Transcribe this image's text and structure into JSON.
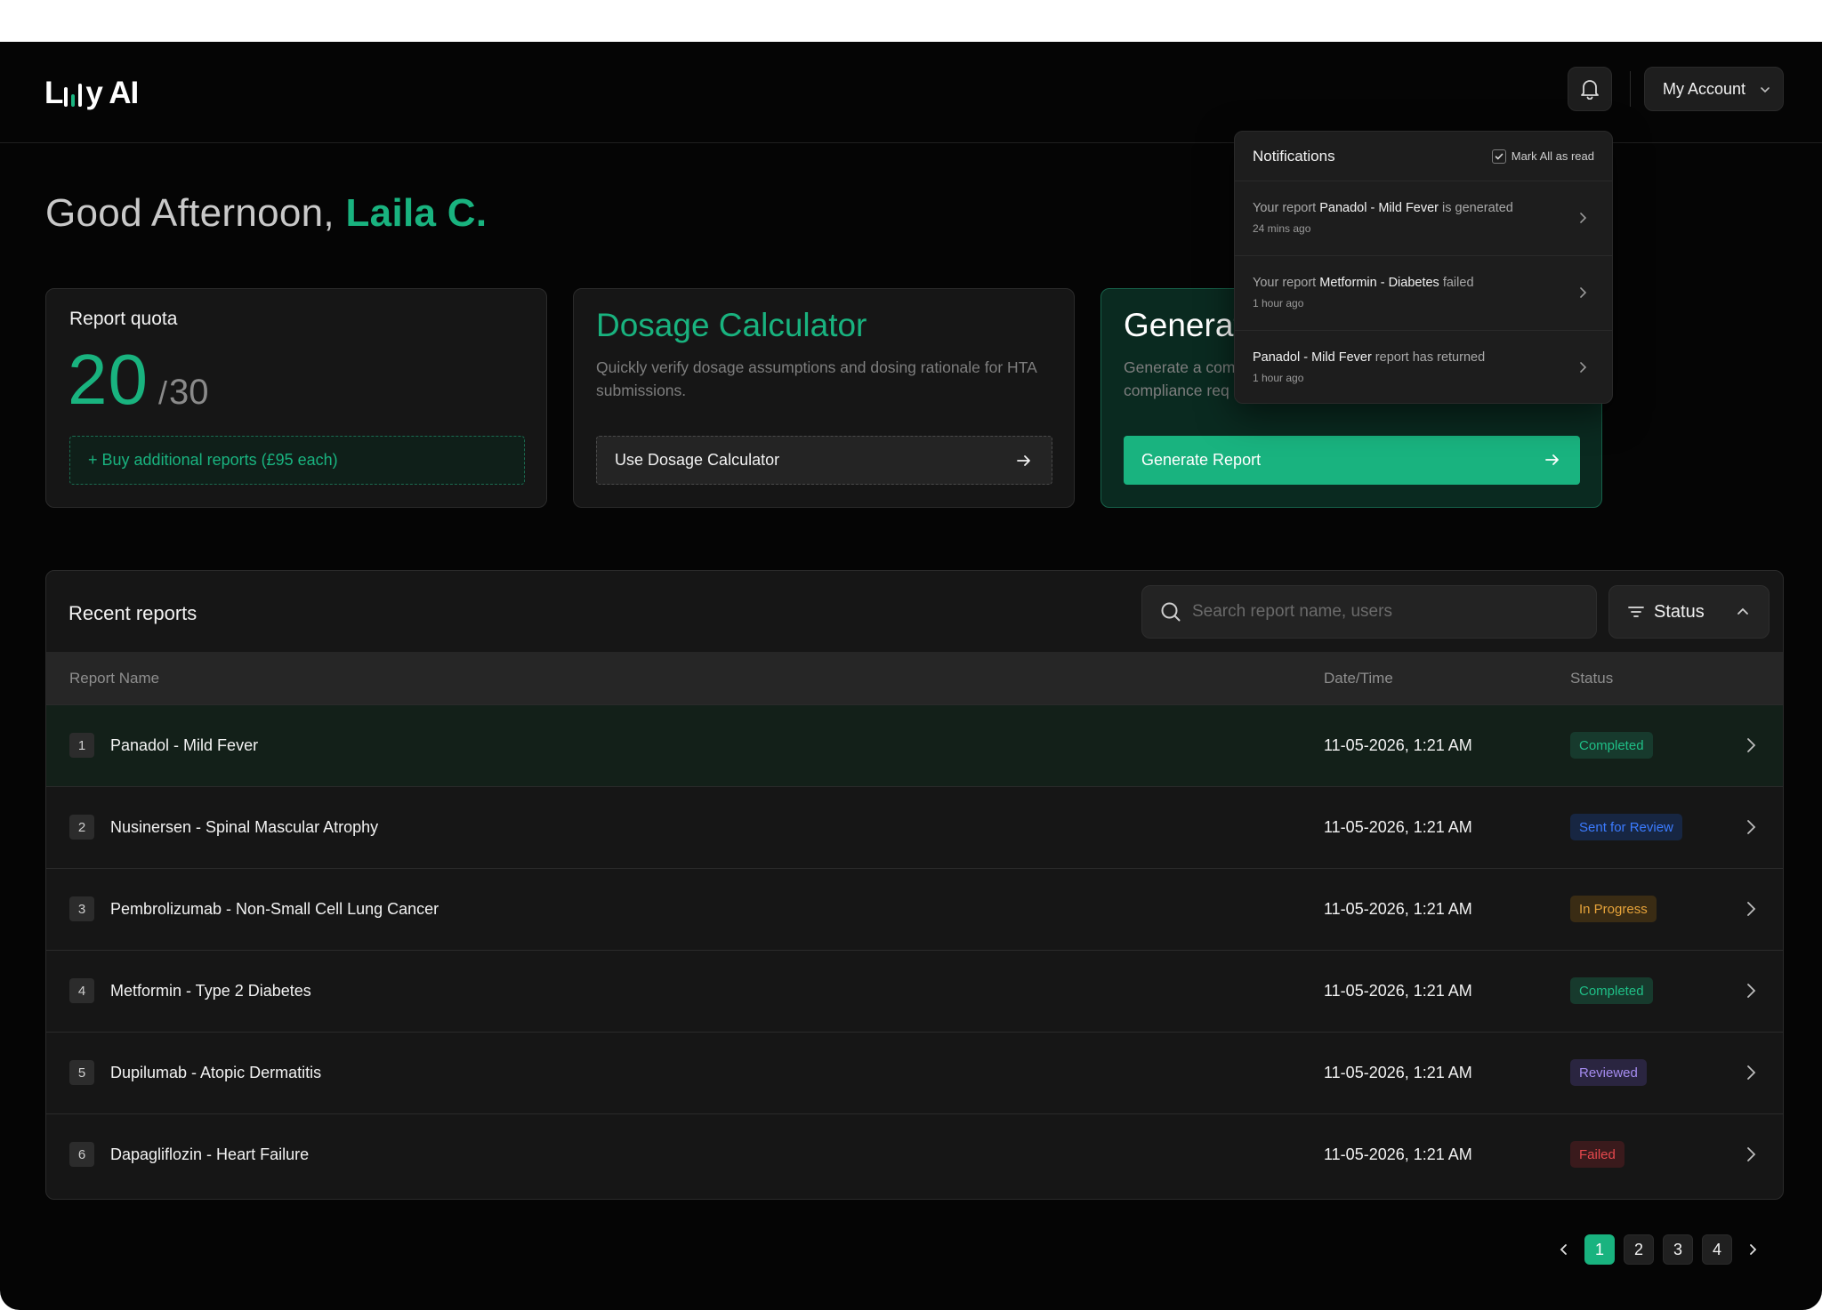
{
  "header": {
    "logo_prefix": "L",
    "logo_suffix": "y AI",
    "account_label": "My Account"
  },
  "greeting": {
    "prefix": "Good Afternoon,",
    "name": "Laila C."
  },
  "quota": {
    "title": "Report quota",
    "used": "20",
    "total": "30",
    "buy_label": "+ Buy additional reports (£95 each)"
  },
  "dosage": {
    "title": "Dosage Calculator",
    "description": "Quickly verify dosage assumptions and dosing rationale for HTA submissions.",
    "button_label": "Use Dosage Calculator"
  },
  "generate": {
    "title": "Generat",
    "description_line1": "Generate a com",
    "description_line2": "compliance req",
    "button_label": "Generate Report"
  },
  "notifications": {
    "title": "Notifications",
    "mark_all_label": "Mark All as read",
    "items": [
      {
        "pre": "Your report ",
        "bold": "Panadol - Mild Fever",
        "post": " is generated",
        "time": "24 mins ago"
      },
      {
        "pre": "Your report ",
        "bold": "Metformin - Diabetes",
        "post": " failed",
        "time": "1 hour ago"
      },
      {
        "pre": "",
        "bold": "Panadol - Mild Fever",
        "post": " report has returned",
        "time": "1 hour ago"
      }
    ]
  },
  "reports": {
    "title": "Recent reports",
    "search_placeholder": "Search report name, users",
    "status_filter_label": "Status",
    "columns": {
      "name": "Report Name",
      "date": "Date/Time",
      "status": "Status"
    },
    "rows": [
      {
        "index": "1",
        "name": "Panadol - Mild Fever",
        "date": "11-05-2026, 1:21 AM",
        "status": "Completed"
      },
      {
        "index": "2",
        "name": "Nusinersen - Spinal Mascular Atrophy",
        "date": "11-05-2026, 1:21 AM",
        "status": "Sent for Review"
      },
      {
        "index": "3",
        "name": "Pembrolizumab - Non-Small Cell Lung Cancer",
        "date": "11-05-2026, 1:21 AM",
        "status": "In Progress"
      },
      {
        "index": "4",
        "name": "Metformin - Type 2 Diabetes",
        "date": "11-05-2026, 1:21 AM",
        "status": "Completed"
      },
      {
        "index": "5",
        "name": "Dupilumab - Atopic Dermatitis",
        "date": "11-05-2026, 1:21 AM",
        "status": "Reviewed"
      },
      {
        "index": "6",
        "name": "Dapagliflozin - Heart Failure",
        "date": "11-05-2026, 1:21 AM",
        "status": "Failed"
      }
    ]
  },
  "pagination": {
    "pages": [
      "1",
      "2",
      "3",
      "4"
    ],
    "current": "1"
  },
  "colors": {
    "accent": "#19b37f",
    "background": "#050505",
    "card": "#161616",
    "status_completed": "#1fbf87",
    "status_sent_for_review": "#3b7bff",
    "status_in_progress": "#e6a33a",
    "status_reviewed": "#a58cf0",
    "status_failed": "#e5484d"
  },
  "icons": {
    "notifications": "bell-icon",
    "account": "chevron-down-icon",
    "search": "search-icon",
    "filter": "filter-lines-icon",
    "arrow": "arrow-right-icon",
    "row": "chevron-right-icon"
  }
}
